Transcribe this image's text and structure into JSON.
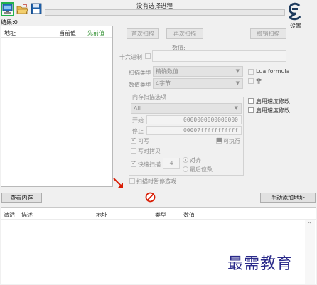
{
  "toolbar": {
    "process_title": "没有选择进程",
    "settings_label": "设置"
  },
  "found": "结果:0",
  "result_list": {
    "columns": [
      "地址",
      "当前值",
      "先前值"
    ]
  },
  "scan_buttons": {
    "first_scan": "首次扫描",
    "next_scan": "再次扫描",
    "undo_scan": "撤销扫描"
  },
  "value": {
    "label": "数值:",
    "hex_label": "十六进制",
    "input": ""
  },
  "scan_type": {
    "label": "扫描类型",
    "value": "精确数值"
  },
  "value_type": {
    "label": "数值类型",
    "value": "4字节"
  },
  "options": {
    "lua_formula": "Lua formula",
    "not": "非",
    "speedhack_1": "启用速度修改",
    "speedhack_2": "启用速度修改"
  },
  "memory": {
    "group_label": "内存扫描选项",
    "region": "All",
    "start_label": "开始",
    "start_value": "0000000000000000",
    "stop_label": "停止",
    "stop_value": "00007fffffffffff",
    "writable": "可写",
    "executable": "可执行",
    "copy_on_write": "写时拷贝",
    "fast_scan": "快速扫描",
    "fast_scan_value": "4",
    "alignment": "对齐",
    "last_digits": "最后位数",
    "pause_game": "扫描时暂停游戏"
  },
  "bottom_bar": {
    "view_memory": "查看内存",
    "add_address": "手动添加地址"
  },
  "address_list": {
    "columns": [
      "激活",
      "描述",
      "地址",
      "类型",
      "数值"
    ]
  },
  "watermark": "最需教育",
  "colors": {
    "highlight_green": "#22b14c",
    "red_arrow": "#d81e06"
  }
}
